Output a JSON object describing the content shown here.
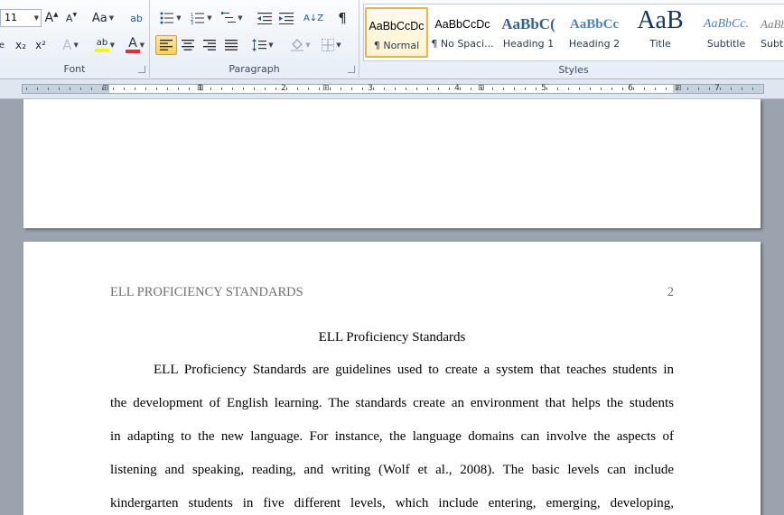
{
  "ribbon": {
    "font_group": {
      "label": "Font",
      "font_size": "11",
      "grow_font": "A",
      "shrink_font": "A",
      "change_case": "Aa",
      "clear_format": "ab",
      "strikethrough": "abc",
      "subscript": "x₂",
      "superscript": "x²",
      "text_effects": "A",
      "highlight": "ab",
      "font_color": "A"
    },
    "paragraph_group": {
      "label": "Paragraph",
      "show_marks": "¶",
      "sort": "A↓Z"
    },
    "styles_group": {
      "label": "Styles",
      "items": [
        {
          "sample": "AaBbCcDc",
          "name": "¶ Normal"
        },
        {
          "sample": "AaBbCcDc",
          "name": "¶ No Spaci..."
        },
        {
          "sample": "AaBbC(",
          "name": "Heading 1"
        },
        {
          "sample": "AaBbCc",
          "name": "Heading 2"
        },
        {
          "sample": "AaB",
          "name": "Title"
        },
        {
          "sample": "AaBbCc.",
          "name": "Subtitle"
        },
        {
          "sample": "AaBbCcDc",
          "name": "Subtl"
        }
      ]
    }
  },
  "ruler": {
    "numbers": [
      "1",
      "2",
      "3",
      "4",
      "5",
      "6",
      "7"
    ]
  },
  "document": {
    "running_head": "ELL PROFICIENCY STANDARDS",
    "page_number": "2",
    "title": "ELL Proficiency Standards",
    "lines": [
      "ELL Proficiency Standards are guidelines used to create a system that teaches students in",
      "the development of English learning. The standards create an environment that helps the students",
      "in adapting to the new language. For instance, the language domains can involve the aspects of",
      "listening and speaking, reading, and writing (Wolf et al., 2008). The basic levels can include",
      "kindergarten students in five different levels, which include entering, emerging, developing,"
    ]
  },
  "colors": {
    "ribbon_bg": "#e6edf6",
    "active_button": "#f9cf5b",
    "font_color_bar": "#e03030",
    "highlight_bar": "#f5f51e",
    "heading_blue": "#365f91"
  }
}
